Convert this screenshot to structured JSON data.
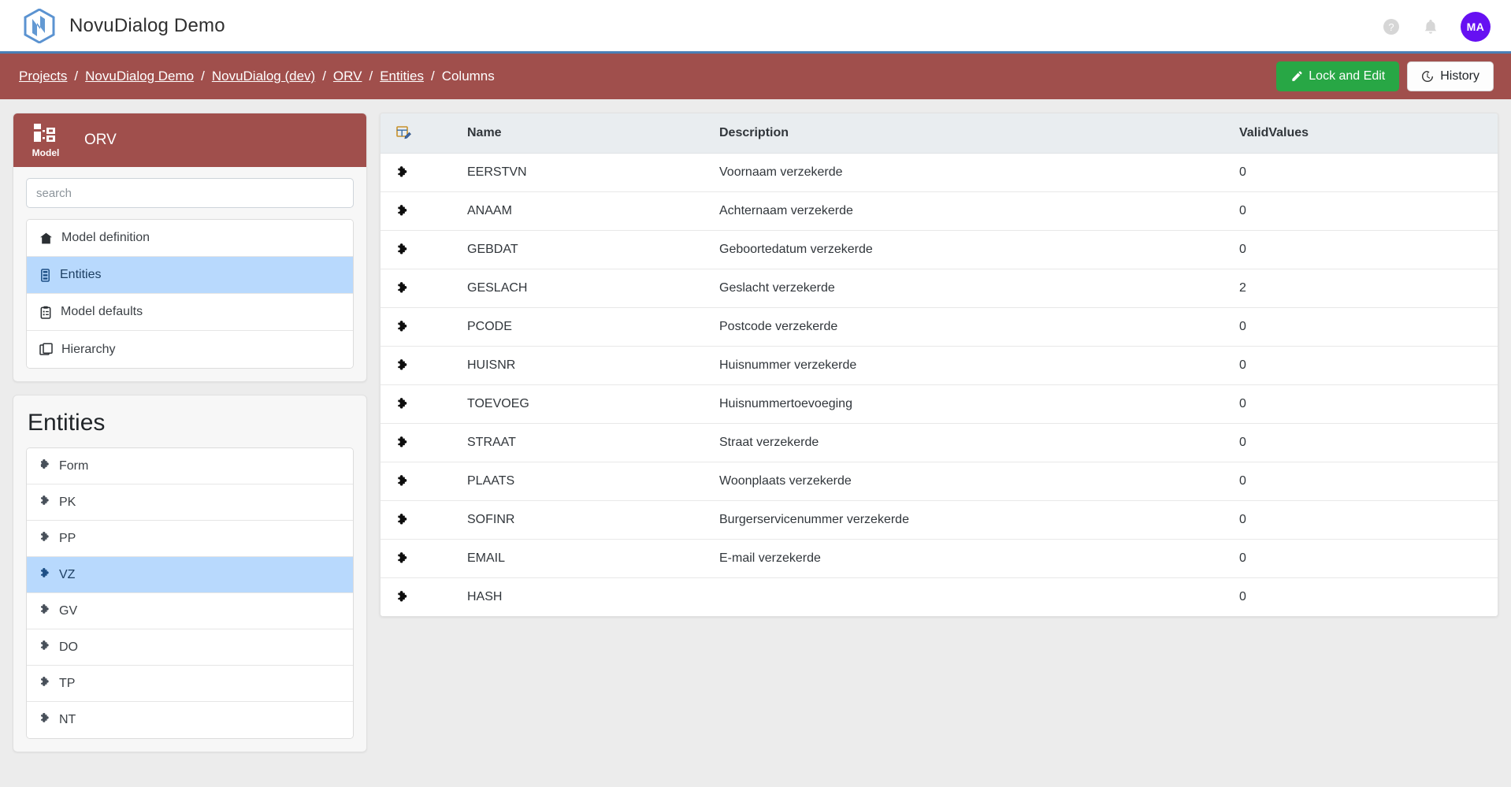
{
  "topbar": {
    "brand_title": "NovuDialog Demo",
    "logo_icon": "novudialog-hexagon-logo",
    "help_icon": "question-circle-icon",
    "bell_icon": "bell-icon",
    "avatar_initials": "MA",
    "avatar_color": "#6610f2",
    "accent_underline": "#4a7fb5"
  },
  "breadcrumb": {
    "bar_color": "#a04f4c",
    "items": [
      {
        "label": "Projects",
        "link": true
      },
      {
        "label": "NovuDialog Demo",
        "link": true
      },
      {
        "label": "NovuDialog (dev)",
        "link": true
      },
      {
        "label": "ORV",
        "link": true
      },
      {
        "label": "Entities",
        "link": true
      },
      {
        "label": "Columns",
        "link": false
      }
    ],
    "separator": "/",
    "lock_edit_label": "Lock and Edit",
    "lock_edit_icon": "pencil-icon",
    "lock_edit_color": "#28a745",
    "history_label": "History",
    "history_icon": "clock-history-icon"
  },
  "sidebar": {
    "header": {
      "badge_icon": "model-diagram-icon",
      "badge_label": "Model",
      "title": "ORV"
    },
    "search": {
      "value": "",
      "placeholder": "search"
    },
    "nav_items": [
      {
        "label": "Model definition",
        "icon": "home-icon",
        "active": false
      },
      {
        "label": "Entities",
        "icon": "database-icon",
        "active": true
      },
      {
        "label": "Model defaults",
        "icon": "clipboard-icon",
        "active": false
      },
      {
        "label": "Hierarchy",
        "icon": "copy-icon",
        "active": false
      }
    ],
    "entities": {
      "title": "Entities",
      "items": [
        {
          "label": "Form",
          "icon": "puzzle-icon",
          "active": false
        },
        {
          "label": "PK",
          "icon": "puzzle-icon",
          "active": false
        },
        {
          "label": "PP",
          "icon": "puzzle-icon",
          "active": false
        },
        {
          "label": "VZ",
          "icon": "puzzle-icon",
          "active": true
        },
        {
          "label": "GV",
          "icon": "puzzle-icon",
          "active": false
        },
        {
          "label": "DO",
          "icon": "puzzle-icon",
          "active": false
        },
        {
          "label": "TP",
          "icon": "puzzle-icon",
          "active": false
        },
        {
          "label": "NT",
          "icon": "puzzle-icon",
          "active": false
        }
      ]
    },
    "selection_color": "#b8d9fd"
  },
  "table": {
    "header_icon": "edit-columns-icon",
    "columns": [
      "",
      "Name",
      "Description",
      "ValidValues"
    ],
    "rows": [
      {
        "icon": "puzzle-icon",
        "name": "EERSTVN",
        "description": "Voornaam verzekerde",
        "validvalues": "0"
      },
      {
        "icon": "puzzle-icon",
        "name": "ANAAM",
        "description": "Achternaam verzekerde",
        "validvalues": "0"
      },
      {
        "icon": "puzzle-icon",
        "name": "GEBDAT",
        "description": "Geboortedatum verzekerde",
        "validvalues": "0"
      },
      {
        "icon": "puzzle-icon",
        "name": "GESLACH",
        "description": "Geslacht verzekerde",
        "validvalues": "2"
      },
      {
        "icon": "puzzle-icon",
        "name": "PCODE",
        "description": "Postcode verzekerde",
        "validvalues": "0"
      },
      {
        "icon": "puzzle-icon",
        "name": "HUISNR",
        "description": "Huisnummer verzekerde",
        "validvalues": "0"
      },
      {
        "icon": "puzzle-icon",
        "name": "TOEVOEG",
        "description": "Huisnummertoevoeging",
        "validvalues": "0"
      },
      {
        "icon": "puzzle-icon",
        "name": "STRAAT",
        "description": "Straat verzekerde",
        "validvalues": "0"
      },
      {
        "icon": "puzzle-icon",
        "name": "PLAATS",
        "description": "Woonplaats verzekerde",
        "validvalues": "0"
      },
      {
        "icon": "puzzle-icon",
        "name": "SOFINR",
        "description": "Burgerservicenummer verzekerde",
        "validvalues": "0"
      },
      {
        "icon": "puzzle-icon",
        "name": "EMAIL",
        "description": "E-mail verzekerde",
        "validvalues": "0"
      },
      {
        "icon": "puzzle-icon",
        "name": "HASH",
        "description": "",
        "validvalues": "0"
      }
    ]
  }
}
